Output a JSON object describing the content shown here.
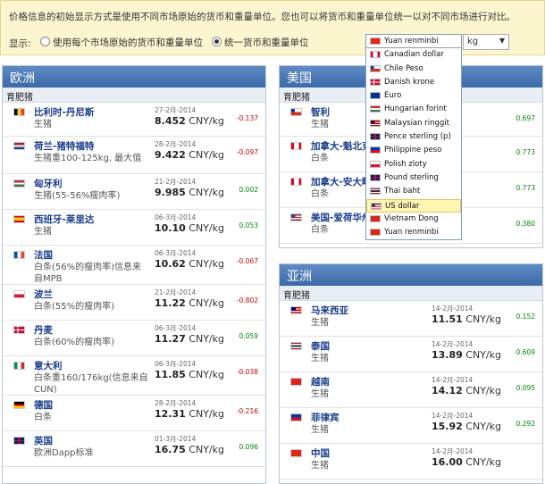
{
  "notice": {
    "text": "价格信息的初始显示方式是使用不同市场原始的货币和重量单位。您也可以将货币和重量单位统一以对不同市场进行对比。",
    "display_label": "显示:",
    "option_original": "使用每个市场原始的货币和重量单位",
    "option_unified": "统一货币和重量单位",
    "selected_option": "统一货币和重量单位",
    "currency_selected": "Yuan renminbi",
    "weight_unit": "kg"
  },
  "currency_options": [
    {
      "label": "Yuan renminbi",
      "flag": "cn"
    },
    {
      "label": "Canadian dollar",
      "flag": "ca"
    },
    {
      "label": "Chile Peso",
      "flag": "cl"
    },
    {
      "label": "Danish krone",
      "flag": "dk"
    },
    {
      "label": "Euro",
      "flag": "eu"
    },
    {
      "label": "Hungarian forint",
      "flag": "hu"
    },
    {
      "label": "Malaysian ringgit",
      "flag": "my"
    },
    {
      "label": "Pence sterling (p)",
      "flag": "gb"
    },
    {
      "label": "Philippine peso",
      "flag": "ph"
    },
    {
      "label": "Polish zloty",
      "flag": "pl"
    },
    {
      "label": "Pound sterling",
      "flag": "gb"
    },
    {
      "label": "Thai baht",
      "flag": "th"
    },
    {
      "label": "US dollar",
      "flag": "us"
    },
    {
      "label": "Vietnam Dong",
      "flag": "vn"
    },
    {
      "label": "Yuan renminbi",
      "flag": "cn"
    }
  ],
  "highlighted_option": "US dollar",
  "europe": {
    "title": "欧洲",
    "sub": "育肥猪",
    "rows": [
      {
        "country": "比利时-丹尼斯",
        "type": "生猪",
        "date": "27-2月-2014",
        "price": "8.452",
        "unit": "CNY/kg",
        "change": "-0.137",
        "dir": "neg",
        "flag": "be"
      },
      {
        "country": "荷兰-猪特福特",
        "type": "生猪重100-125kg, 最大值",
        "date": "28-2月-2014",
        "price": "9.422",
        "unit": "CNY/kg",
        "change": "-0.097",
        "dir": "neg",
        "flag": "nl"
      },
      {
        "country": "匈牙利",
        "type": "生猪(55-56%瘦肉率)",
        "date": "21-2月-2014",
        "price": "9.985",
        "unit": "CNY/kg",
        "change": "0.002",
        "dir": "pos",
        "flag": "hu"
      },
      {
        "country": "西班牙-莱里达",
        "type": "生猪",
        "date": "06-3月-2014",
        "price": "10.10",
        "unit": "CNY/kg",
        "change": "0.053",
        "dir": "pos",
        "flag": "es"
      },
      {
        "country": "法国",
        "type": "白条(56%的瘦肉率)信息来自MPB",
        "date": "06-3月-2014",
        "price": "10.62",
        "unit": "CNY/kg",
        "change": "-0.067",
        "dir": "neg",
        "flag": "fr"
      },
      {
        "country": "波兰",
        "type": "白条(55%的瘦肉率)",
        "date": "21-2月-2014",
        "price": "11.22",
        "unit": "CNY/kg",
        "change": "-0.802",
        "dir": "neg",
        "flag": "pl"
      },
      {
        "country": "丹麦",
        "type": "白条(60%的瘦肉率)",
        "date": "06-3月-2014",
        "price": "11.27",
        "unit": "CNY/kg",
        "change": "0.059",
        "dir": "pos",
        "flag": "dk"
      },
      {
        "country": "意大利",
        "type": "白条重160/176kg(信息来自CUN)",
        "date": "06-3月-2014",
        "price": "11.85",
        "unit": "CNY/kg",
        "change": "-0.038",
        "dir": "neg",
        "flag": "it"
      },
      {
        "country": "德国",
        "type": "白条",
        "date": "28-2月-2014",
        "price": "12.31",
        "unit": "CNY/kg",
        "change": "-0.216",
        "dir": "neg",
        "flag": "de"
      },
      {
        "country": "英国",
        "type": "欧洲Dapp标准",
        "date": "01-3月-2014",
        "price": "16.75",
        "unit": "CNY/kg",
        "change": "0.096",
        "dir": "pos",
        "flag": "gb"
      }
    ]
  },
  "america": {
    "title": "美国",
    "sub": "育肥猪",
    "rows": [
      {
        "country": "智利",
        "type": "生猪",
        "date": "",
        "price": "",
        "unit": "",
        "change": "0.697",
        "dir": "pos",
        "flag": "cl"
      },
      {
        "country": "加拿大-魁北克",
        "type": "白条",
        "date": "",
        "price": "",
        "unit": "",
        "change": "0.773",
        "dir": "pos",
        "flag": "ca"
      },
      {
        "country": "加拿大-安大略",
        "type": "白条",
        "date": "",
        "price": "",
        "unit": "",
        "change": "0.773",
        "dir": "pos",
        "flag": "ca"
      },
      {
        "country": "美国-爱荷华州",
        "type": "白条",
        "date": "",
        "price": "",
        "unit": "",
        "change": "0.380",
        "dir": "pos",
        "flag": "us"
      }
    ]
  },
  "asia": {
    "title": "亚洲",
    "sub": "育肥猪",
    "rows": [
      {
        "country": "马来西亚",
        "type": "生猪",
        "date": "14-2月-2014",
        "price": "11.51",
        "unit": "CNY/kg",
        "change": "0.152",
        "dir": "pos",
        "flag": "my"
      },
      {
        "country": "泰国",
        "type": "生猪",
        "date": "14-2月-2014",
        "price": "13.89",
        "unit": "CNY/kg",
        "change": "0.609",
        "dir": "pos",
        "flag": "th"
      },
      {
        "country": "越南",
        "type": "生猪",
        "date": "14-2月-2014",
        "price": "14.12",
        "unit": "CNY/kg",
        "change": "0.095",
        "dir": "pos",
        "flag": "vn"
      },
      {
        "country": "菲律宾",
        "type": "生猪",
        "date": "14-2月-2014",
        "price": "15.92",
        "unit": "CNY/kg",
        "change": "0.292",
        "dir": "pos",
        "flag": "ph"
      },
      {
        "country": "中国",
        "type": "生猪",
        "date": "14-2月-2014",
        "price": "16.00",
        "unit": "CNY/kg",
        "change": "",
        "dir": "pos",
        "flag": "cn"
      }
    ]
  }
}
